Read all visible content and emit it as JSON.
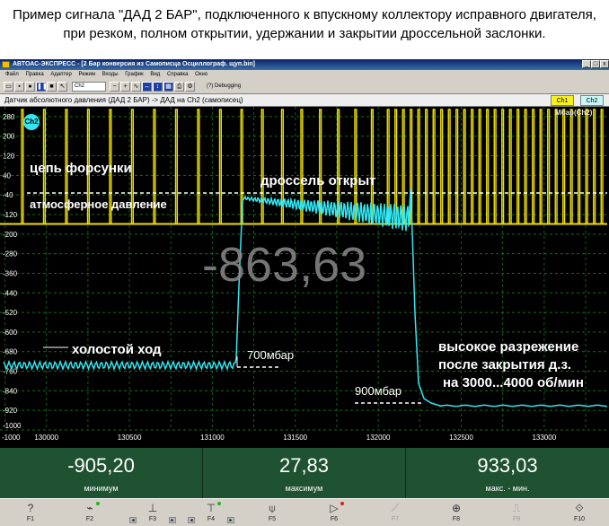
{
  "caption": {
    "line1": "Пример сигнала \"ДАД 2 БАР\", подключенного к впускному коллектору исправного двигателя,",
    "line2": "при резком, полном открытии, удержании и закрытии дроссельной заслонки."
  },
  "window": {
    "title": "АВТОАС-ЭКСПРЕСС - [2 Бар конверсия из Самописца Осциллограф. щуп.bin]",
    "controls": [
      "_",
      "□",
      "x"
    ]
  },
  "menu": [
    "Файл",
    "Правка",
    "Адаптер",
    "Режим",
    "Входы",
    "График",
    "Вид",
    "Справка",
    "Окно",
    "(?) Debugging"
  ],
  "toolbar": {
    "channel_select": "Ch2"
  },
  "channel_bar": {
    "label": "Датчик абсолютного давления (ДАД 2 БАР) -> ДАД на Ch2 (самописец)",
    "ch1_button": "Ch1",
    "ch2_button": "Ch2"
  },
  "plot": {
    "channel_badge": "Ch2",
    "units": "Мбар(Ch2)",
    "big_value": "-863,63",
    "annotations": {
      "injector": "цепь форсунки",
      "throttle_open": "дроссель открыт",
      "atmospheric": "атмосферное давление",
      "idle": "холостой ход",
      "p700": "700мбар",
      "p900": "900мбар",
      "high_vacuum_1": "высокое разрежение",
      "high_vacuum_2": "после закрытия д.з.",
      "high_vacuum_3": "на 3000...4000 об/мин"
    },
    "y_ticks": [
      "280",
      "200",
      "120",
      "40",
      "-40",
      "-120",
      "-200",
      "-280",
      "-360",
      "-440",
      "-520",
      "-600",
      "-680",
      "-760",
      "-840",
      "-920",
      "-1000"
    ],
    "x_ticks": [
      "130000",
      "130500",
      "131000",
      "131500",
      "132000",
      "132500",
      "133000"
    ],
    "colors": {
      "injector": "#f0e000",
      "pressure": "#33e6f2",
      "background": "#000000",
      "grid": "#1a8a1a"
    }
  },
  "chart_data": {
    "type": "line",
    "title": "",
    "xlabel": "",
    "ylabel": "Мбар(Ch2)",
    "xlim": [
      129720,
      133380
    ],
    "ylim": [
      -1000,
      320
    ],
    "grid": true,
    "series": [
      {
        "name": "Ch2",
        "points": [
          [
            129720,
            -720
          ],
          [
            130760,
            -720
          ],
          [
            130790,
            -670
          ],
          [
            130830,
            -45
          ],
          [
            131000,
            -40
          ],
          [
            131300,
            -60
          ],
          [
            131600,
            -75
          ],
          [
            131800,
            -55
          ],
          [
            131850,
            0
          ],
          [
            131880,
            -850
          ],
          [
            131960,
            -915
          ],
          [
            132100,
            -935
          ],
          [
            133380,
            -935
          ]
        ]
      }
    ]
  },
  "readouts": [
    {
      "value": "-905,20",
      "label": "минимум"
    },
    {
      "value": "27,83",
      "label": "максимум"
    },
    {
      "value": "933,03",
      "label": "макс. - мин."
    }
  ],
  "fkeys": [
    {
      "icon": "help-icon",
      "glyph": "?",
      "label": "F1"
    },
    {
      "icon": "signal-select-icon",
      "glyph": "⌁",
      "label": "F2"
    },
    {
      "icon": "horizontal-cursor-icon",
      "glyph": "⊥",
      "label": "F3"
    },
    {
      "icon": "vertical-cursor-icon",
      "glyph": "⊤",
      "label": "F4"
    },
    {
      "icon": "probe-icon",
      "glyph": "⍦",
      "label": "F5"
    },
    {
      "icon": "trigger-icon",
      "glyph": "▷",
      "label": "F6"
    },
    {
      "icon": "filter-icon",
      "glyph": "⟋",
      "label": "F7"
    },
    {
      "icon": "crosshair-icon",
      "glyph": "⊕",
      "label": "F8"
    },
    {
      "icon": "edge-icon",
      "glyph": "⎍",
      "label": "F9"
    },
    {
      "icon": "export-icon",
      "glyph": "⟐",
      "label": "F10"
    }
  ]
}
